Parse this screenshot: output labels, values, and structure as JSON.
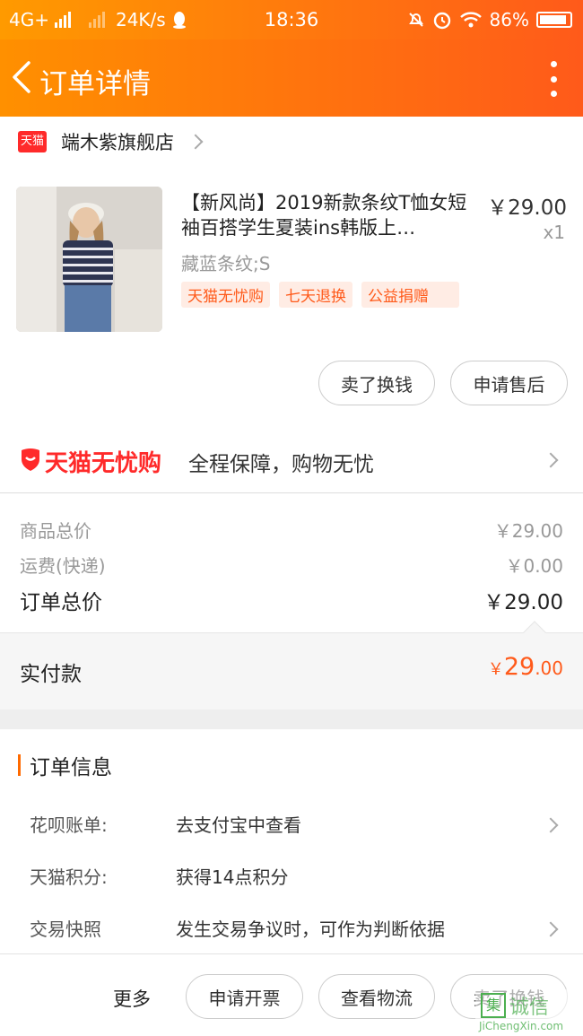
{
  "status_bar": {
    "network": "4G+",
    "speed": "24K/s",
    "time": "18:36",
    "battery": "86%"
  },
  "nav": {
    "title": "订单详情"
  },
  "shop": {
    "logo_text": "天猫",
    "name": "端木紫旗舰店"
  },
  "product": {
    "title": "【新风尚】2019新款条纹T恤女短袖百搭学生夏装ins韩版上…",
    "price": "￥29.00",
    "quantity": "x1",
    "spec": "藏蓝条纹;S",
    "tags": [
      "天猫无忧购",
      "七天退换",
      "公益捐赠"
    ]
  },
  "item_actions": {
    "sell_label": "卖了换钱",
    "aftersale_label": "申请售后"
  },
  "assurance": {
    "brand": "天猫无忧购",
    "desc": "全程保障，购物无忧"
  },
  "price_summary": {
    "goods_label": "商品总价",
    "goods_value": "￥29.00",
    "shipping_label": "运费(快递)",
    "shipping_value": "￥0.00",
    "total_label": "订单总价",
    "total_value": "￥29.00",
    "paid_label": "实付款",
    "paid_currency": "￥",
    "paid_int": "29",
    "paid_dec": ".00"
  },
  "order_info": {
    "title": "订单信息",
    "rows": [
      {
        "key": "花呗账单:",
        "value": "去支付宝中查看"
      },
      {
        "key": "天猫积分:",
        "value": "获得14点积分"
      },
      {
        "key": "交易快照",
        "value": "发生交易争议时，可作为判断依据"
      }
    ]
  },
  "bottom_bar": {
    "more_label": "更多",
    "invoice_label": "申请开票",
    "logistics_label": "查看物流",
    "sell_label": "卖了换钱"
  },
  "watermark": {
    "logo": "集",
    "text": "诚信",
    "url": "JiChengXin.com"
  },
  "colors": {
    "accent": "#ff5a1a",
    "tmall_red": "#ff2a2a"
  }
}
